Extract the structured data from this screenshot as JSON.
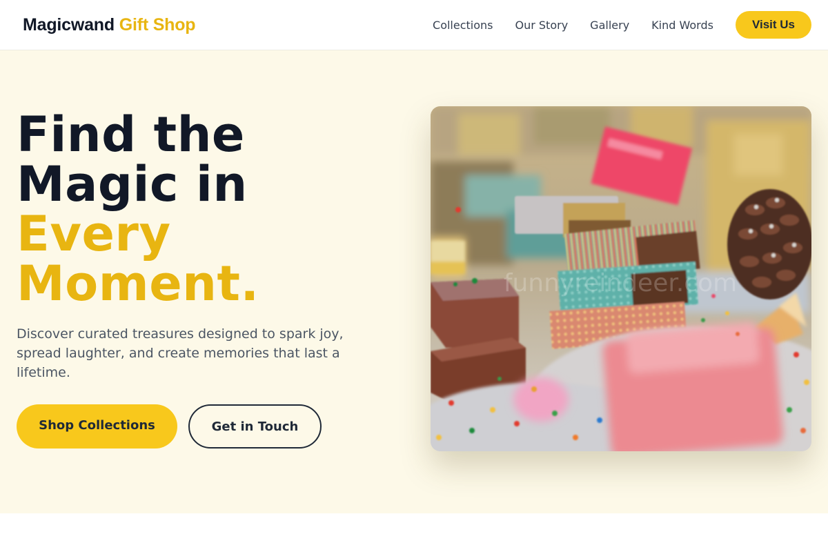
{
  "nav": {
    "logo_brand": "Magicwand",
    "logo_accent": "Gift Shop",
    "links": [
      "Collections",
      "Our Story",
      "Gallery",
      "Kind Words"
    ],
    "visit_label": "Visit Us"
  },
  "hero": {
    "headline_line1": "Find the",
    "headline_line2": "Magic in",
    "headline_line3": "Every",
    "headline_line4": "Moment.",
    "description": "Discover curated treasures designed to spark joy, spread laughter, and create memories that last a lifetime.",
    "primary_cta": "Shop Collections",
    "secondary_cta": "Get in Touch",
    "image_watermark": "funnyreindeer.com"
  },
  "colors": {
    "accent": "#f8c81c",
    "accent_text": "#e8b511",
    "hero_background": "#fdf9e8",
    "dark_text": "#111827"
  }
}
